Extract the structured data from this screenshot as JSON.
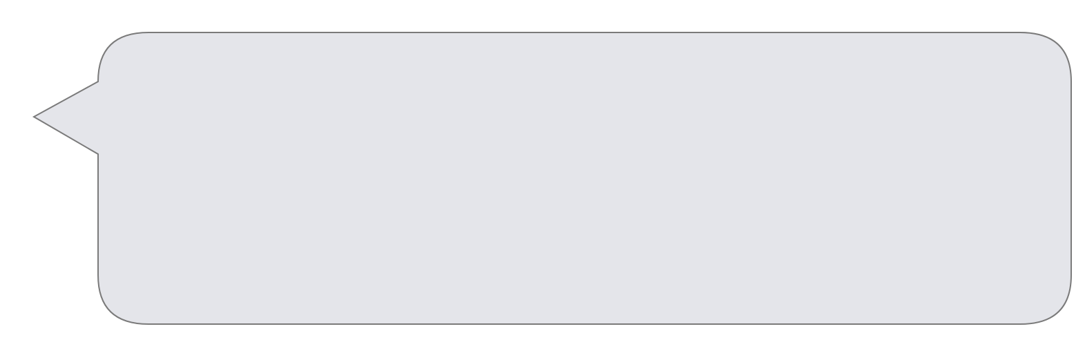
{
  "callout": {
    "text": "",
    "fill_color": "#e4e5ea",
    "border_color": "#7a7a7a",
    "pointer_direction": "left"
  }
}
